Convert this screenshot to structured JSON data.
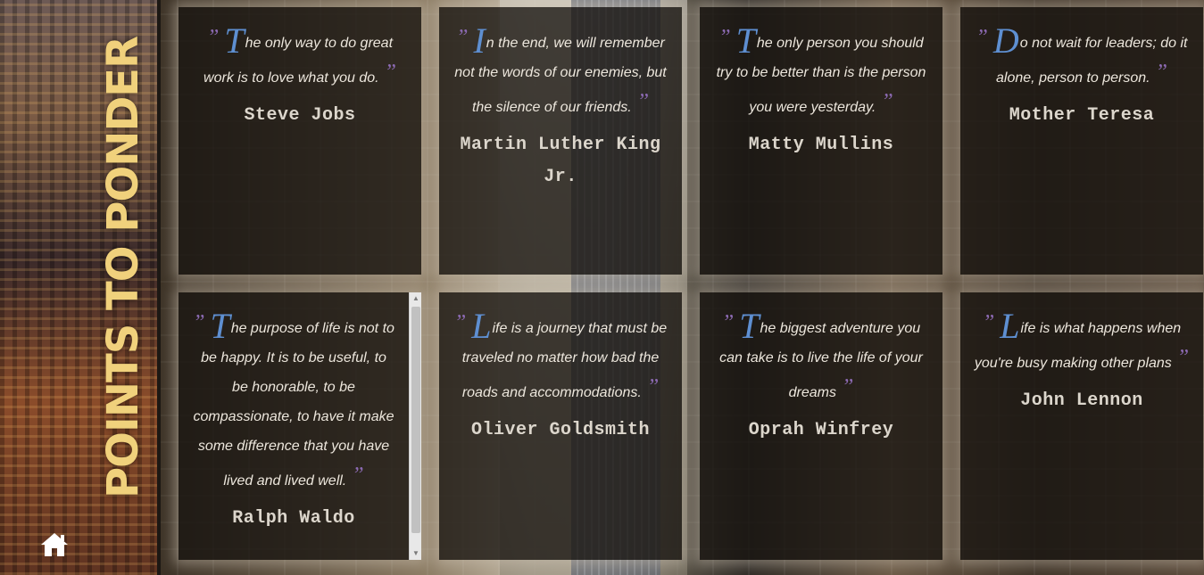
{
  "poster": {
    "title": "POINTS TO PONDER",
    "home_icon": "home-icon"
  },
  "cards": [
    {
      "initial": "T",
      "text": "he only way to do great work is to love what you do.",
      "author": "Steve Jobs"
    },
    {
      "initial": "I",
      "text": "n the end, we will remember not the words of our enemies, but the silence of our friends.",
      "author": "Martin Luther King Jr."
    },
    {
      "initial": "T",
      "text": "he only person you should try to be better than is the person you were yesterday.",
      "author": "Matty Mullins"
    },
    {
      "initial": "D",
      "text": "o not wait for leaders; do it alone, person to person.",
      "author": "Mother Teresa"
    },
    {
      "initial": "T",
      "text": "he purpose of life is not to be happy. It is to be useful, to be honorable, to be compassionate, to have it make some difference that you have lived and lived well.",
      "author": "Ralph Waldo"
    },
    {
      "initial": "L",
      "text": "ife is a journey that must be traveled no matter how bad the roads and accommodations.",
      "author": "Oliver Goldsmith"
    },
    {
      "initial": "T",
      "text": "he biggest adventure you can take is to live the life of your dreams",
      "author": "Oprah Winfrey"
    },
    {
      "initial": "L",
      "text": "ife is what happens when you're busy making other plans",
      "author": "John Lennon"
    }
  ],
  "quote_marks": {
    "open": "”",
    "close": "”"
  },
  "colors": {
    "title": "#f0d17c",
    "initial": "#5e8fd1",
    "quote_mark": "#8c6ab3",
    "card_bg": "#181411"
  }
}
